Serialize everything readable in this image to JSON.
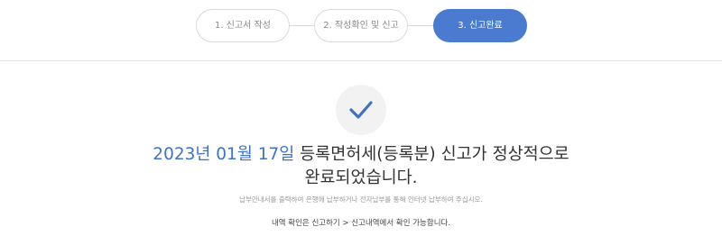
{
  "steps": [
    {
      "label": "1. 신고서 작성",
      "active": false
    },
    {
      "label": "2. 작성확인 및 신고",
      "active": false
    },
    {
      "label": "3. 신고완료",
      "active": true
    }
  ],
  "icon": "check-icon",
  "colors": {
    "accent": "#4a7bd1",
    "date": "#3f72c6"
  },
  "result": {
    "date": "2023년 01월 17일",
    "message_rest": " 등록면허세(등록분) 신고가 정상적으로",
    "message_line2": "완료되었습니다.",
    "notice": "납부안내서를 출력하여 은행에 납부하거나 전자납부를 통해 인터넷 납부하여 주십시오.",
    "history_hint": "내역 확인은 신고하기 > 신고내역에서 확인 가능합니다."
  }
}
